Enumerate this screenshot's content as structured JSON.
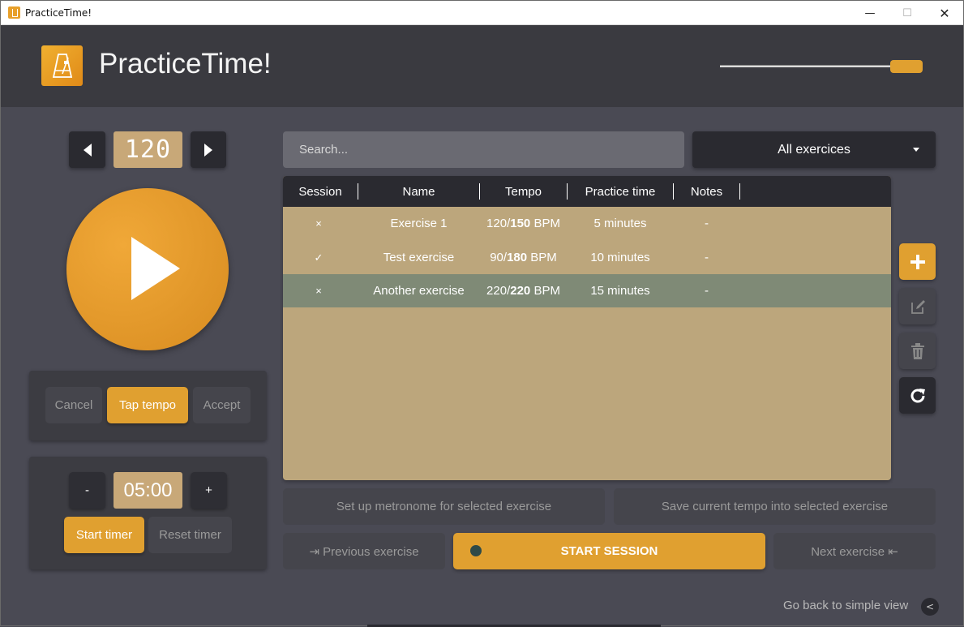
{
  "window": {
    "title": "PracticeTime!",
    "minimize": "—",
    "maximize": "☐",
    "close": "✕"
  },
  "header": {
    "app_title": "PracticeTime!",
    "logo_icon": "metronome-icon"
  },
  "tempo": {
    "value": "120",
    "decrease_icon": "triangle-left-icon",
    "increase_icon": "triangle-right-icon"
  },
  "play": {
    "icon": "play-icon"
  },
  "tap_panel": {
    "cancel": "Cancel",
    "tap_tempo": "Tap tempo",
    "accept": "Accept"
  },
  "timer": {
    "minus": "-",
    "value": "05:00",
    "plus": "+",
    "start": "Start timer",
    "reset": "Reset timer"
  },
  "search": {
    "placeholder": "Search..."
  },
  "filter": {
    "selected": "All exercices"
  },
  "table": {
    "columns": [
      "Session",
      "Name",
      "Tempo",
      "Practice time",
      "Notes"
    ],
    "rows": [
      {
        "session": "×",
        "name": "Exercise 1",
        "tempo_current": "120",
        "tempo_target": "150",
        "tempo_unit": "BPM",
        "practice_time": "5 minutes",
        "notes": "-",
        "selected": false
      },
      {
        "session": "✓",
        "name": "Test exercise",
        "tempo_current": "90",
        "tempo_target": "180",
        "tempo_unit": "BPM",
        "practice_time": "10 minutes",
        "notes": "-",
        "selected": false
      },
      {
        "session": "×",
        "name": "Another exercise",
        "tempo_current": "220",
        "tempo_target": "220",
        "tempo_unit": "BPM",
        "practice_time": "15 minutes",
        "notes": "-",
        "selected": true
      }
    ]
  },
  "side_buttons": {
    "add": "plus-icon",
    "edit": "edit-icon",
    "delete": "trash-icon",
    "refresh": "refresh-icon"
  },
  "actions": {
    "setup": "Set up metronome for selected exercise",
    "save_tempo": "Save current tempo into selected exercise",
    "previous": "⇥ Previous exercise",
    "start_session": "START SESSION",
    "next": "Next exercise ⇤"
  },
  "footer": {
    "back_link": "Go back to simple view",
    "back_icon": "<"
  },
  "colors": {
    "accent": "#e0a030",
    "background": "#4a4a54",
    "header": "#3a3a40",
    "table_bg": "#bca67c",
    "selected_row": "#7f8a76"
  }
}
